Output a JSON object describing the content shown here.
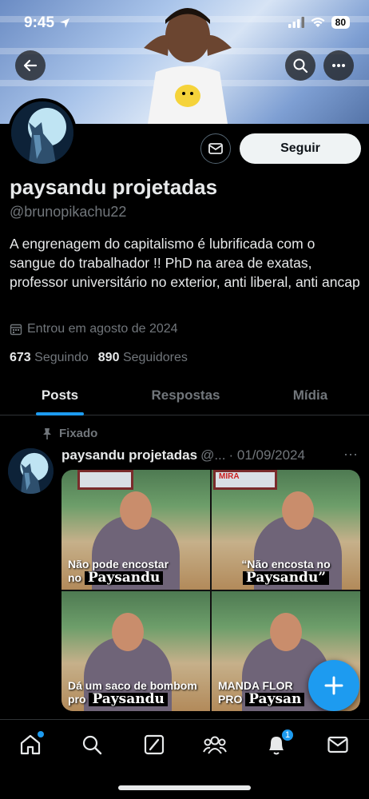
{
  "status_bar": {
    "time": "9:45",
    "battery": "80"
  },
  "header": {
    "back_icon": "arrow-left-icon",
    "search_icon": "search-icon",
    "more_icon": "more-horizontal-icon"
  },
  "profile": {
    "display_name": "paysandu projetadas",
    "handle": "@brunopikachu22",
    "bio": "A engrenagem do capitalismo é lubrificada com o sangue do trabalhador !! PhD na area de exatas, professor universitário no exterior, anti liberal, anti ancap",
    "joined": "Entrou em agosto de 2024",
    "following_count": "673",
    "following_label": "Seguindo",
    "followers_count": "890",
    "followers_label": "Seguidores",
    "follow_button": "Seguir"
  },
  "tabs": [
    {
      "label": "Posts",
      "active": true
    },
    {
      "label": "Respostas",
      "active": false
    },
    {
      "label": "Mídia",
      "active": false
    }
  ],
  "post": {
    "pinned_label": "Fixado",
    "author": "paysandu projetadas",
    "handle_truncated": "@...",
    "date": "· 01/09/2024",
    "more": "···",
    "panels": [
      {
        "line1": "Não pode encostar",
        "line2_prefix": "no",
        "big": "Paysandu"
      },
      {
        "line1": "“Não encosta no",
        "line2_prefix": "",
        "big": "Paysandu”"
      },
      {
        "line1": "Dá um saco de bombom",
        "line2_prefix": "pro",
        "big": "Paysandu"
      },
      {
        "line1": "MANDA FLOR",
        "line2_prefix": "PRO",
        "big": "Paysan"
      }
    ],
    "board_text": "MIRA"
  },
  "bottom_nav": {
    "items": [
      "home-icon",
      "search-icon",
      "grok-icon",
      "communities-icon",
      "notifications-icon",
      "messages-icon"
    ],
    "notifications_badge": "1"
  },
  "colors": {
    "accent": "#1d9bf0",
    "background": "#000000",
    "muted": "#71767b"
  }
}
